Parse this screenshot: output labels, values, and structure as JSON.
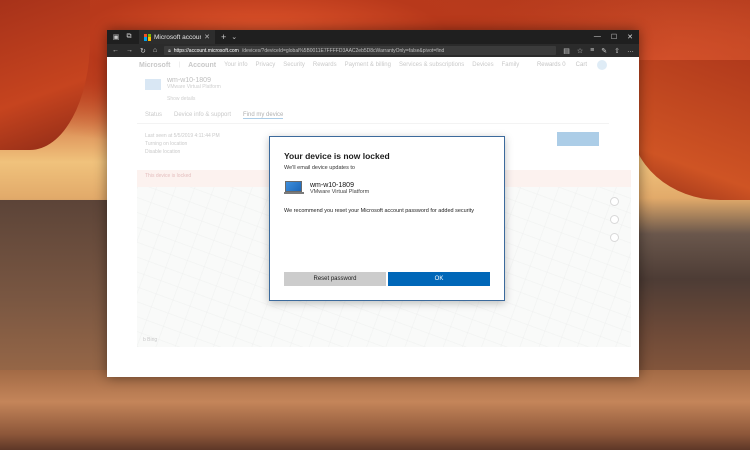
{
  "browser": {
    "tab_title": "Microsoft account | Dev",
    "url_host": "https://account.microsoft.com",
    "url_path": "/devices/?deviceId=global%5B0011E7FFFFD3AAC2eb5D8cWarrantyOnly=false&pivot=find"
  },
  "site": {
    "brand": "Microsoft",
    "section": "Account",
    "nav": [
      "Your info",
      "Privacy",
      "Security",
      "Rewards",
      "Payment & billing",
      "Services & subscriptions",
      "Devices",
      "Family"
    ],
    "right": [
      "Rewards 0",
      "Cart"
    ]
  },
  "device": {
    "name": "wm-w10-1809",
    "model": "VMware Virtual Platform",
    "action": "Show details"
  },
  "subtabs": [
    "Status",
    "Device info & support",
    "Find my device"
  ],
  "location": {
    "line1": "Last seen at 5/5/2019 4:11:44 PM",
    "line2": "Turning on location",
    "line3": "Disable location"
  },
  "alert": {
    "line1": "This device is locked",
    "line2": ""
  },
  "map": {
    "attribution": "b Bing"
  },
  "dialog": {
    "title": "Your device is now locked",
    "subtitle": "We'll email device updates to",
    "device_name": "wm-w10-1809",
    "device_model": "VMware Virtual Platform",
    "recommendation": "We recommend you reset your Microsoft account password for added security",
    "secondary_button": "Reset password",
    "primary_button": "OK"
  },
  "colors": {
    "accent": "#0067b8",
    "dialog_border": "#3c6a9c",
    "secondary_button": "#cccccc"
  }
}
